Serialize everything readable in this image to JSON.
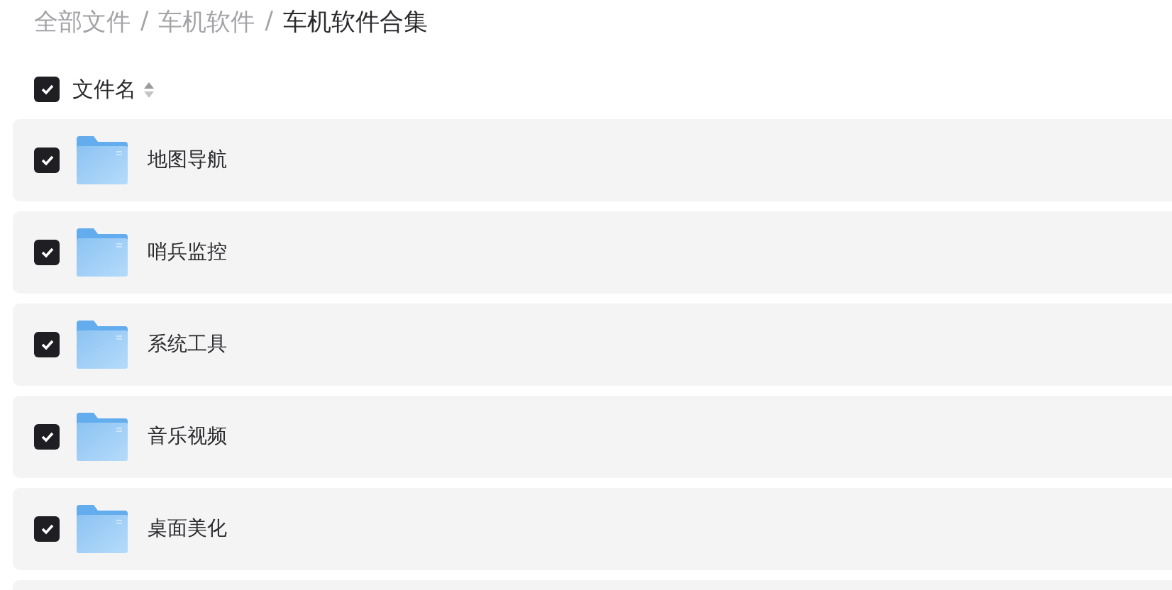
{
  "breadcrumb": [
    {
      "label": "全部文件",
      "current": false
    },
    {
      "label": "车机软件",
      "current": false
    },
    {
      "label": "车机软件合集",
      "current": true
    }
  ],
  "breadcrumb_separator": "/",
  "header": {
    "label": "文件名",
    "checked": true
  },
  "rows": [
    {
      "name": "地图导航",
      "checked": true
    },
    {
      "name": "哨兵监控",
      "checked": true
    },
    {
      "name": "系统工具",
      "checked": true
    },
    {
      "name": "音乐视频",
      "checked": true
    },
    {
      "name": "桌面美化",
      "checked": true
    }
  ]
}
